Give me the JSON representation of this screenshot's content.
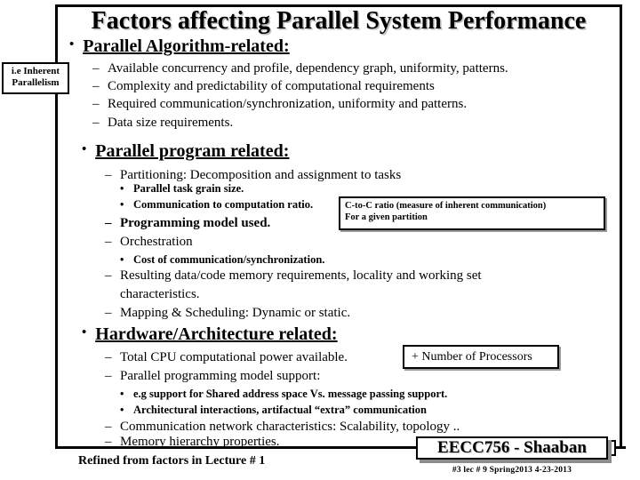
{
  "slide": {
    "title": "Factors affecting Parallel System Performance",
    "footer_note": "Refined from factors in Lecture # 1",
    "logo": "EECC756 - Shaaban",
    "footer_meta": "#3  lec # 9   Spring2013  4-23-2013"
  },
  "sections": [
    {
      "heading": "Parallel Algorithm-related:",
      "bullet": "•",
      "items": [
        "Available concurrency and profile, dependency graph, uniformity, patterns.",
        "Complexity and predictability of computational requirements",
        "Required communication/synchronization, uniformity and patterns.",
        "Data size requirements."
      ]
    },
    {
      "heading": "Parallel program related:",
      "bullet": "•",
      "items": [
        "Partitioning: Decomposition and assignment to tasks",
        "Parallel task grain size.",
        "Communication to computation ratio.",
        "Programming model used.",
        "Orchestration",
        "Cost of communication/synchronization.",
        "Resulting data/code memory requirements, locality and working set",
        "characteristics.",
        "Mapping & Scheduling: Dynamic or static."
      ]
    },
    {
      "heading": "Hardware/Architecture related:",
      "bullet": "•",
      "items": [
        "Total CPU computational power available.",
        "Parallel programming model support:",
        "e.g support for Shared address space Vs. message passing support.",
        "Architectural interactions, artifactual “extra” communication",
        "Communication network characteristics: Scalability, topology ..",
        "Memory hierarchy properties."
      ]
    }
  ],
  "callouts": {
    "inherent": {
      "line1": "i.e Inherent",
      "line2": "Parallelism"
    },
    "ctoc": {
      "line1": "C-to-C ratio (measure of inherent communication)",
      "line2": "For a given partition"
    },
    "processors": {
      "label": "+ Number of Processors"
    }
  },
  "marks": {
    "dash": "–",
    "dot": "•"
  }
}
